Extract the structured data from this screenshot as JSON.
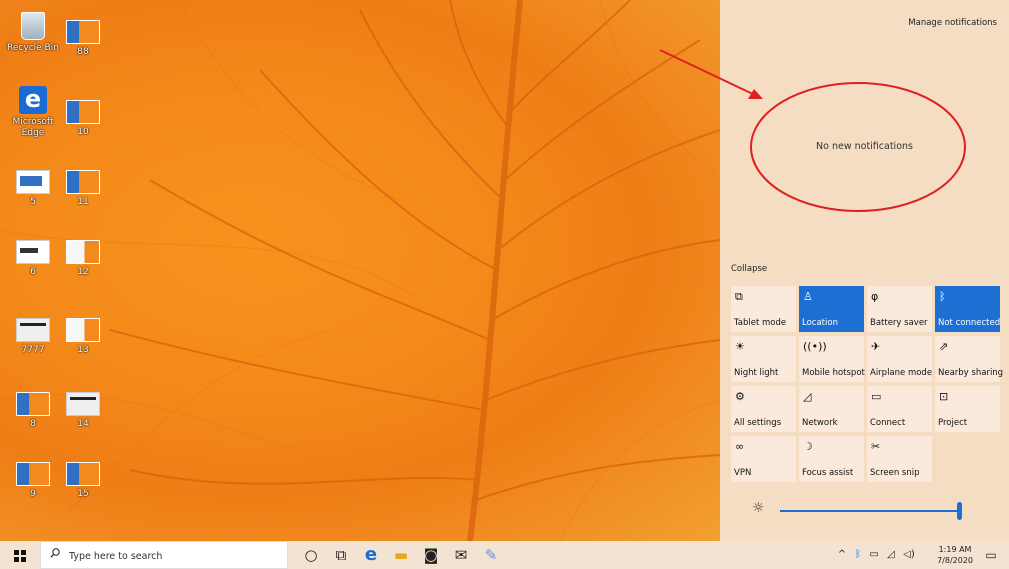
{
  "desktop": {
    "icons": [
      {
        "label": "Recycle Bin",
        "icon": "recycle-bin-icon"
      },
      {
        "label": "Microsoft Edge",
        "icon": "edge-icon"
      },
      {
        "label": "5",
        "icon": "screenshot-icon"
      },
      {
        "label": "6",
        "icon": "screenshot-icon"
      },
      {
        "label": "7777",
        "icon": "screenshot-icon"
      },
      {
        "label": "8",
        "icon": "folder-icon"
      },
      {
        "label": "9",
        "icon": "folder-icon"
      },
      {
        "label": "88",
        "icon": "folder-icon"
      },
      {
        "label": "10",
        "icon": "folder-icon"
      },
      {
        "label": "11",
        "icon": "folder-icon"
      },
      {
        "label": "12",
        "icon": "folder-icon"
      },
      {
        "label": "13",
        "icon": "folder-icon"
      },
      {
        "label": "14",
        "icon": "screenshot-icon"
      },
      {
        "label": "15",
        "icon": "folder-icon"
      }
    ]
  },
  "action_center": {
    "manage_notifications": "Manage notifications",
    "no_notifications": "No new notifications",
    "collapse": "Collapse",
    "tiles": [
      {
        "label": "Tablet mode",
        "icon": "tablet-mode-icon",
        "glyph": "⧉",
        "on": false
      },
      {
        "label": "Location",
        "icon": "location-icon",
        "glyph": "♙",
        "on": true
      },
      {
        "label": "Battery saver",
        "icon": "battery-saver-icon",
        "glyph": "φ",
        "on": false
      },
      {
        "label": "Not connected",
        "icon": "bluetooth-icon",
        "glyph": "ᛒ",
        "on": true
      },
      {
        "label": "Night light",
        "icon": "night-light-icon",
        "glyph": "☀",
        "on": false
      },
      {
        "label": "Mobile hotspot",
        "icon": "mobile-hotspot-icon",
        "glyph": "((•))",
        "on": false
      },
      {
        "label": "Airplane mode",
        "icon": "airplane-icon",
        "glyph": "✈",
        "on": false
      },
      {
        "label": "Nearby sharing",
        "icon": "nearby-sharing-icon",
        "glyph": "⇗",
        "on": false
      },
      {
        "label": "All settings",
        "icon": "settings-icon",
        "glyph": "⚙",
        "on": false
      },
      {
        "label": "Network",
        "icon": "network-icon",
        "glyph": "◿",
        "on": false
      },
      {
        "label": "Connect",
        "icon": "connect-icon",
        "glyph": "▭",
        "on": false
      },
      {
        "label": "Project",
        "icon": "project-icon",
        "glyph": "⊡",
        "on": false
      },
      {
        "label": "VPN",
        "icon": "vpn-icon",
        "glyph": "∞",
        "on": false
      },
      {
        "label": "Focus assist",
        "icon": "focus-assist-icon",
        "glyph": "☽",
        "on": false
      },
      {
        "label": "Screen snip",
        "icon": "screen-snip-icon",
        "glyph": "✂",
        "on": false
      }
    ],
    "brightness": 1.0
  },
  "taskbar": {
    "search_placeholder": "Type here to search",
    "apps": [
      {
        "icon": "cortana-icon",
        "glyph": "○"
      },
      {
        "icon": "task-view-icon",
        "glyph": "⧉"
      },
      {
        "icon": "edge-icon",
        "glyph": "e"
      },
      {
        "icon": "file-explorer-icon",
        "glyph": "▬"
      },
      {
        "icon": "store-icon",
        "glyph": "◙"
      },
      {
        "icon": "mail-icon",
        "glyph": "✉"
      },
      {
        "icon": "paint-icon",
        "glyph": "✎"
      }
    ],
    "time": "1:19 AM",
    "date": "7/8/2020"
  },
  "colors": {
    "accent": "#1e6fd3",
    "annotation": "#e02020",
    "action_center_bg": "#f5ddc3",
    "wallpaper": "#f48a1a"
  }
}
